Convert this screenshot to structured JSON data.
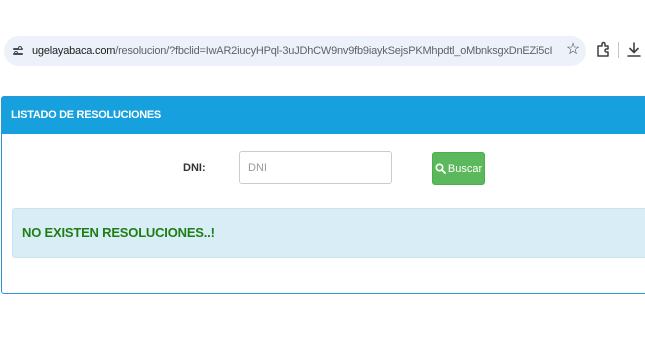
{
  "browser": {
    "url_domain": "ugelayabaca.com",
    "url_path": "/resolucion/?fbclid=IwAR2iucyHPql-3uJDhCW9nv9fb9iaykSejsPKMhpdtl_oMbnksgxDnEZi5cI",
    "icons": [
      "site-info-icon",
      "star-icon",
      "extensions-icon",
      "download-icon"
    ]
  },
  "panel": {
    "title": "LISTADO DE RESOLUCIONES"
  },
  "search": {
    "label": "DNI:",
    "placeholder": "DNI",
    "value": "",
    "button_label": "Buscar"
  },
  "alert": {
    "message": "NO EXISTEN RESOLUCIONES..!"
  },
  "colors": {
    "heading_bg": "#16a0dd",
    "button_bg": "#5cb85c",
    "alert_bg": "#d9edf7",
    "alert_text": "#1e7e14"
  }
}
